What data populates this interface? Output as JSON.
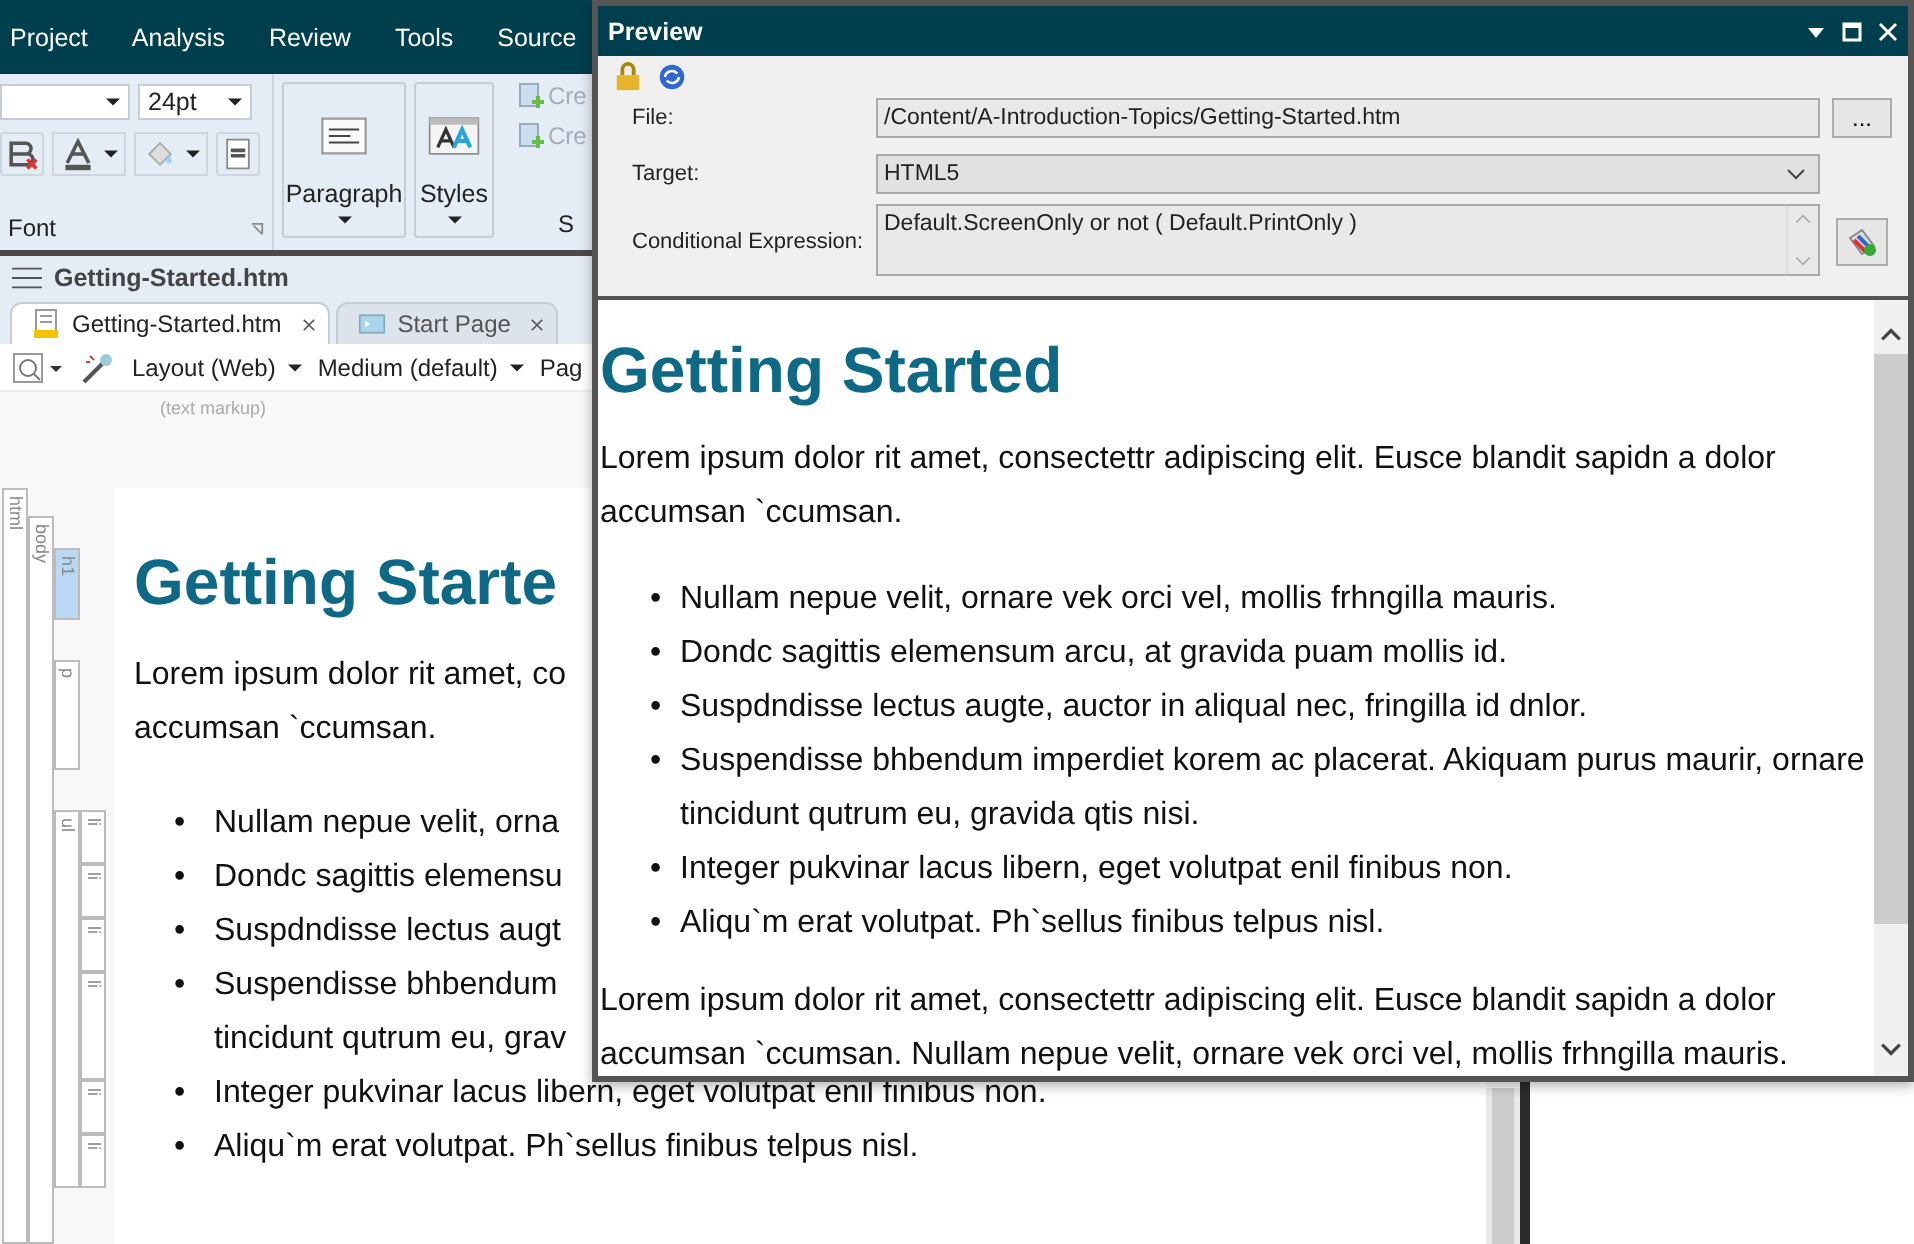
{
  "menu": [
    "Project",
    "Analysis",
    "Review",
    "Tools",
    "Source"
  ],
  "ribbon": {
    "font_size": "24pt",
    "font_group_label": "Font",
    "groups": [
      {
        "label": "Paragraph",
        "kind": "paragraph"
      },
      {
        "label": "Styles",
        "kind": "styles"
      }
    ],
    "create_items": [
      "Cre",
      "Cre"
    ],
    "next_group_label": "S"
  },
  "document": {
    "title": "Getting-Started.htm",
    "tabs": [
      {
        "label": "Getting-Started.htm",
        "selected": true,
        "kind": "topic"
      },
      {
        "label": "Start Page",
        "selected": false,
        "kind": "start"
      }
    ],
    "toolbar": [
      "Layout (Web)",
      "Medium (default)",
      "Pag"
    ],
    "markup_hint": "(text markup)",
    "structure": {
      "root": "html",
      "body": "body",
      "item_labels": [
        "li",
        "li",
        "li",
        "li",
        "li",
        "li"
      ],
      "tags": [
        {
          "label": "h1",
          "selected": true,
          "kind": "heading"
        },
        {
          "label": "p",
          "selected": false,
          "kind": "paragraph"
        },
        {
          "label": "ul",
          "selected": false,
          "kind": "list"
        }
      ]
    },
    "content": {
      "heading": "Getting Starte",
      "paragraph_lines": [
        "Lorem ipsum dolor rit amet, co",
        "accumsan `ccumsan."
      ],
      "list_lines": [
        {
          "marker": "•",
          "text": "Nullam nepue velit, orna"
        },
        {
          "marker": "•",
          "text": "Dondc sagittis elemensu"
        },
        {
          "marker": "•",
          "text": "Suspdndisse lectus augt"
        },
        {
          "marker": "•",
          "text": "Suspendisse bhbendum"
        },
        {
          "text": "tincidunt qutrum eu, grav"
        },
        {
          "marker": "•",
          "text": "Integer pukvinar lacus libern, eget volutpat enil finibus non."
        },
        {
          "marker": "•",
          "text": "Aliqu`m erat volutpat. Ph`sellus finibus telpus nisl."
        }
      ]
    }
  },
  "preview": {
    "title": "Preview",
    "file": {
      "label": "File:",
      "value": "/Content/A-Introduction-Topics/Getting-Started.htm",
      "button": "..."
    },
    "target": {
      "label": "Target:",
      "value": "HTML5"
    },
    "condition": {
      "label": "Conditional Expression:",
      "value": "Default.ScreenOnly or not ( Default.PrintOnly )"
    },
    "content": {
      "heading": "Getting Started",
      "paragraph": "Lorem ipsum dolor rit amet, consectettr adipiscing elit. Eusce blandit sapidn a dolor accumsan `ccumsan.",
      "list": [
        {
          "marker": "•",
          "text": "Nullam nepue velit, ornare vek orci vel, mollis frhngilla mauris."
        },
        {
          "marker": "•",
          "text": "Dondc sagittis elemensum arcu, at gravida puam mollis id."
        },
        {
          "marker": "•",
          "text": "Suspdndisse lectus augte, auctor in aliqual nec, fringilla id dnlor."
        },
        {
          "marker": "•",
          "text": "Suspendisse bhbendum imperdiet korem ac placerat. Akiquam purus maurir, ornare tincidunt qutrum eu, gravida qtis nisi."
        },
        {
          "marker": "•",
          "text": "Integer pukvinar lacus libern, eget volutpat enil finibus non."
        },
        {
          "marker": "•",
          "text": "Aliqu`m erat volutpat. Ph`sellus finibus telpus nisl."
        }
      ],
      "paragraph_2": "Lorem ipsum dolor rit amet, consectettr adipiscing elit. Eusce blandit sapidn a dolor accumsan `ccumsan. Nullam nepue velit, ornare vek orci vel, mollis frhngilla mauris."
    }
  }
}
